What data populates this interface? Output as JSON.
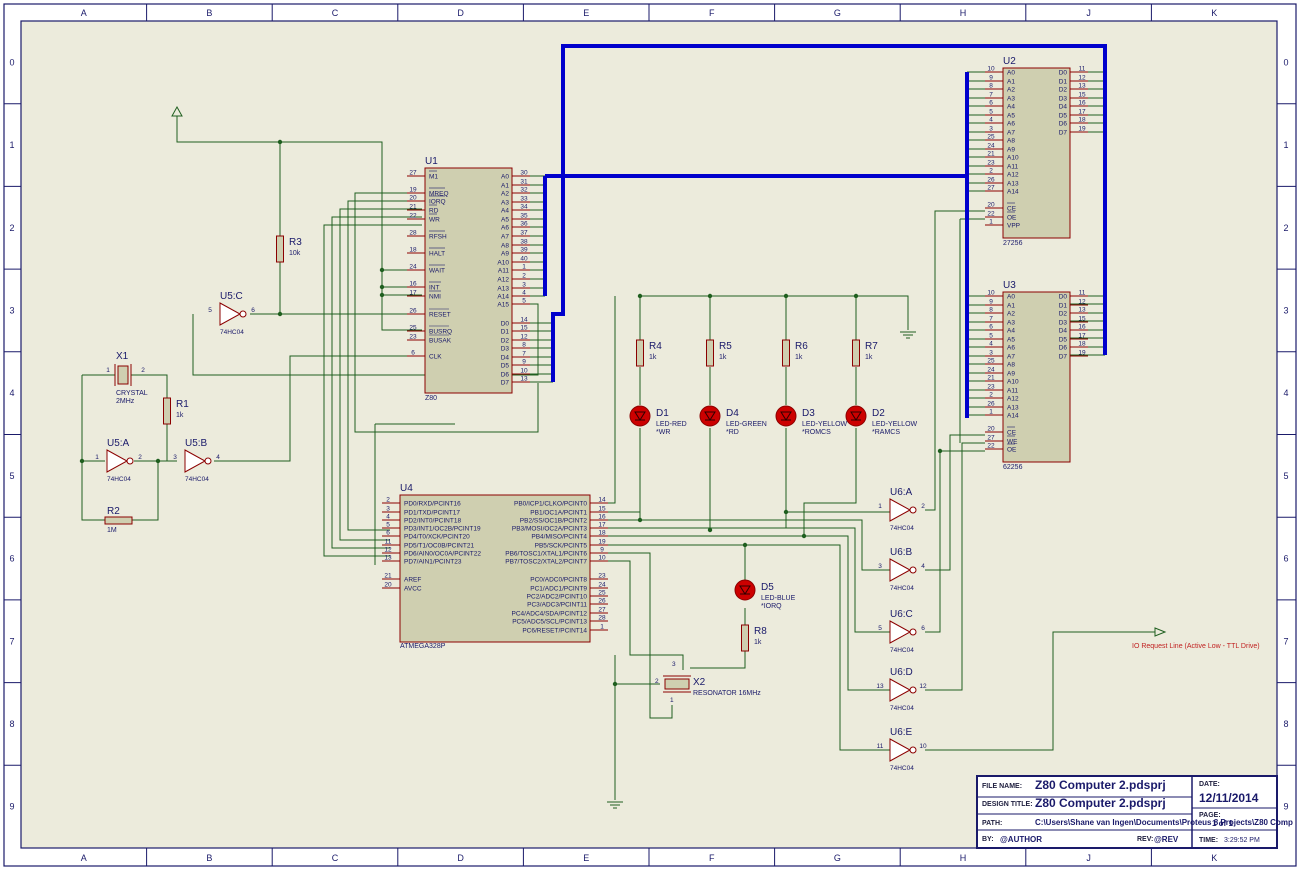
{
  "frame": {
    "cols": [
      "A",
      "B",
      "C",
      "D",
      "E",
      "F",
      "G",
      "H",
      "J",
      "K"
    ],
    "rows": [
      "0",
      "1",
      "2",
      "3",
      "4",
      "5",
      "6",
      "7",
      "8",
      "9"
    ]
  },
  "colors": {
    "wire": "#1f5f1f",
    "bus": "#0000cc",
    "part_outline": "#8b0000",
    "part_fill": "#cfcfb0",
    "text": "#1a1a6a",
    "led": "#cc0000",
    "sheet": "#ecebdc"
  },
  "title_block": {
    "file_name_label": "FILE NAME:",
    "file_name": "Z80 Computer 2.pdsprj",
    "design_title_label": "DESIGN TITLE:",
    "design_title": "Z80 Computer 2.pdsprj",
    "path_label": "PATH:",
    "path": "C:\\Users\\Shane van Ingen\\Documents\\Proteus 8 Projects\\Z80 Comp",
    "by_label": "BY:",
    "by": "@AUTHOR",
    "rev_label": "REV:",
    "rev": "@REV",
    "date_label": "DATE:",
    "date": "12/11/2014",
    "page_label": "PAGE:",
    "page": "1 of 1",
    "time_label": "TIME:",
    "time": "3:29:52 PM"
  },
  "parts": {
    "u1": {
      "ref": "U1",
      "value": "Z80"
    },
    "u2": {
      "ref": "U2",
      "value": "27256"
    },
    "u3": {
      "ref": "U3",
      "value": "62256"
    },
    "u4": {
      "ref": "U4",
      "value": "ATMEGA328P"
    },
    "x1": {
      "ref": "X1",
      "value": "CRYSTAL",
      "value2": "2MHz"
    },
    "x2": {
      "ref": "X2",
      "value": "RESONATOR 16MHz"
    },
    "r1": {
      "ref": "R1",
      "value": "1k"
    },
    "r2": {
      "ref": "R2",
      "value": "1M"
    },
    "r3": {
      "ref": "R3",
      "value": "10k"
    },
    "r4": {
      "ref": "R4",
      "value": "1k"
    },
    "r5": {
      "ref": "R5",
      "value": "1k"
    },
    "r6": {
      "ref": "R6",
      "value": "1k"
    },
    "r7": {
      "ref": "R7",
      "value": "1k"
    },
    "r8": {
      "ref": "R8",
      "value": "1k"
    },
    "d1": {
      "ref": "D1",
      "value": "LED-RED",
      "note": "*WR"
    },
    "d4": {
      "ref": "D4",
      "value": "LED-GREEN",
      "note": "*RD"
    },
    "d3": {
      "ref": "D3",
      "value": "LED-YELLOW",
      "note": "*ROMCS"
    },
    "d2": {
      "ref": "D2",
      "value": "LED-YELLOW",
      "note": "*RAMCS"
    },
    "d5": {
      "ref": "D5",
      "value": "LED-BLUE",
      "note": "*IORQ"
    },
    "gates": [
      {
        "ref": "U5:A",
        "value": "74HC04",
        "in": "1",
        "out": "2"
      },
      {
        "ref": "U5:B",
        "value": "74HC04",
        "in": "3",
        "out": "4"
      },
      {
        "ref": "U5:C",
        "value": "74HC04",
        "in": "5",
        "out": "6"
      },
      {
        "ref": "U6:A",
        "value": "74HC04",
        "in": "1",
        "out": "2"
      },
      {
        "ref": "U6:B",
        "value": "74HC04",
        "in": "3",
        "out": "4"
      },
      {
        "ref": "U6:C",
        "value": "74HC04",
        "in": "5",
        "out": "6"
      },
      {
        "ref": "U6:D",
        "value": "74HC04",
        "in": "13",
        "out": "12"
      },
      {
        "ref": "U6:E",
        "value": "74HC04",
        "in": "11",
        "out": "10"
      }
    ]
  },
  "pins": {
    "u1_left": [
      {
        "n": "27",
        "name": "M1"
      },
      {
        "n": "19",
        "name": "MREQ"
      },
      {
        "n": "20",
        "name": "IORQ"
      },
      {
        "n": "21",
        "name": "RD"
      },
      {
        "n": "22",
        "name": "WR"
      },
      {
        "n": "28",
        "name": "RFSH"
      },
      {
        "n": "18",
        "name": "HALT"
      },
      {
        "n": "24",
        "name": "WAIT"
      },
      {
        "n": "16",
        "name": "INT"
      },
      {
        "n": "17",
        "name": "NMI"
      },
      {
        "n": "26",
        "name": "RESET"
      },
      {
        "n": "25",
        "name": "BUSRQ"
      },
      {
        "n": "23",
        "name": "BUSAK"
      },
      {
        "n": "6",
        "name": "CLK"
      }
    ],
    "u1_right": [
      {
        "n": "30",
        "name": "A0"
      },
      {
        "n": "31",
        "name": "A1"
      },
      {
        "n": "32",
        "name": "A2"
      },
      {
        "n": "33",
        "name": "A3"
      },
      {
        "n": "34",
        "name": "A4"
      },
      {
        "n": "35",
        "name": "A5"
      },
      {
        "n": "36",
        "name": "A6"
      },
      {
        "n": "37",
        "name": "A7"
      },
      {
        "n": "38",
        "name": "A8"
      },
      {
        "n": "39",
        "name": "A9"
      },
      {
        "n": "40",
        "name": "A10"
      },
      {
        "n": "1",
        "name": "A11"
      },
      {
        "n": "2",
        "name": "A12"
      },
      {
        "n": "3",
        "name": "A13"
      },
      {
        "n": "4",
        "name": "A14"
      },
      {
        "n": "5",
        "name": "A15"
      },
      {
        "n": "14",
        "name": "D0"
      },
      {
        "n": "15",
        "name": "D1"
      },
      {
        "n": "12",
        "name": "D2"
      },
      {
        "n": "8",
        "name": "D3"
      },
      {
        "n": "7",
        "name": "D4"
      },
      {
        "n": "9",
        "name": "D5"
      },
      {
        "n": "10",
        "name": "D6"
      },
      {
        "n": "13",
        "name": "D7"
      }
    ],
    "mem_left_u2": [
      {
        "n": "10",
        "name": "A0"
      },
      {
        "n": "9",
        "name": "A1"
      },
      {
        "n": "8",
        "name": "A2"
      },
      {
        "n": "7",
        "name": "A3"
      },
      {
        "n": "6",
        "name": "A4"
      },
      {
        "n": "5",
        "name": "A5"
      },
      {
        "n": "4",
        "name": "A6"
      },
      {
        "n": "3",
        "name": "A7"
      },
      {
        "n": "25",
        "name": "A8"
      },
      {
        "n": "24",
        "name": "A9"
      },
      {
        "n": "21",
        "name": "A10"
      },
      {
        "n": "23",
        "name": "A11"
      },
      {
        "n": "2",
        "name": "A12"
      },
      {
        "n": "26",
        "name": "A13"
      },
      {
        "n": "27",
        "name": "A14"
      },
      {
        "n": "20",
        "name": "CE"
      },
      {
        "n": "22",
        "name": "OE"
      },
      {
        "n": "1",
        "name": "VPP"
      }
    ],
    "mem_left_u3": [
      {
        "n": "10",
        "name": "A0"
      },
      {
        "n": "9",
        "name": "A1"
      },
      {
        "n": "8",
        "name": "A2"
      },
      {
        "n": "7",
        "name": "A3"
      },
      {
        "n": "6",
        "name": "A4"
      },
      {
        "n": "5",
        "name": "A5"
      },
      {
        "n": "4",
        "name": "A6"
      },
      {
        "n": "3",
        "name": "A7"
      },
      {
        "n": "25",
        "name": "A8"
      },
      {
        "n": "24",
        "name": "A9"
      },
      {
        "n": "21",
        "name": "A10"
      },
      {
        "n": "23",
        "name": "A11"
      },
      {
        "n": "2",
        "name": "A12"
      },
      {
        "n": "26",
        "name": "A13"
      },
      {
        "n": "1",
        "name": "A14"
      },
      {
        "n": "20",
        "name": "CE"
      },
      {
        "n": "27",
        "name": "WE"
      },
      {
        "n": "22",
        "name": "OE"
      }
    ],
    "mem_right": [
      {
        "n": "11",
        "name": "D0"
      },
      {
        "n": "12",
        "name": "D1"
      },
      {
        "n": "13",
        "name": "D2"
      },
      {
        "n": "15",
        "name": "D3"
      },
      {
        "n": "16",
        "name": "D4"
      },
      {
        "n": "17",
        "name": "D5"
      },
      {
        "n": "18",
        "name": "D6"
      },
      {
        "n": "19",
        "name": "D7"
      }
    ],
    "u4_left": [
      {
        "n": "2",
        "name": "PD0/RXD/PCINT16"
      },
      {
        "n": "3",
        "name": "PD1/TXD/PCINT17"
      },
      {
        "n": "4",
        "name": "PD2/INT0/PCINT18"
      },
      {
        "n": "5",
        "name": "PD3/INT1/OC2B/PCINT19"
      },
      {
        "n": "6",
        "name": "PD4/T0/XCK/PCINT20"
      },
      {
        "n": "11",
        "name": "PD5/T1/OC0B/PCINT21"
      },
      {
        "n": "12",
        "name": "PD6/AIN0/OC0A/PCINT22"
      },
      {
        "n": "13",
        "name": "PD7/AIN1/PCINT23"
      },
      {
        "n": "21",
        "name": "AREF"
      },
      {
        "n": "20",
        "name": "AVCC"
      }
    ],
    "u4_right": [
      {
        "n": "14",
        "name": "PB0/ICP1/CLKO/PCINT0"
      },
      {
        "n": "15",
        "name": "PB1/OC1A/PCINT1"
      },
      {
        "n": "16",
        "name": "PB2/SS/OC1B/PCINT2"
      },
      {
        "n": "17",
        "name": "PB3/MOSI/OC2A/PCINT3"
      },
      {
        "n": "18",
        "name": "PB4/MISO/PCINT4"
      },
      {
        "n": "19",
        "name": "PB5/SCK/PCINT5"
      },
      {
        "n": "9",
        "name": "PB6/TOSC1/XTAL1/PCINT6"
      },
      {
        "n": "10",
        "name": "PB7/TOSC2/XTAL2/PCINT7"
      },
      {
        "n": "23",
        "name": "PC0/ADC0/PCINT8"
      },
      {
        "n": "24",
        "name": "PC1/ADC1/PCINT9"
      },
      {
        "n": "25",
        "name": "PC2/ADC2/PCINT10"
      },
      {
        "n": "26",
        "name": "PC3/ADC3/PCINT11"
      },
      {
        "n": "27",
        "name": "PC4/ADC4/SDA/PCINT12"
      },
      {
        "n": "28",
        "name": "PC5/ADC5/SCL/PCINT13"
      },
      {
        "n": "1",
        "name": "PC6/RESET/PCINT14"
      }
    ],
    "x2": [
      "3",
      "2",
      "1"
    ]
  },
  "io_label": "IO Request Line (Active Low - TTL Drive)"
}
